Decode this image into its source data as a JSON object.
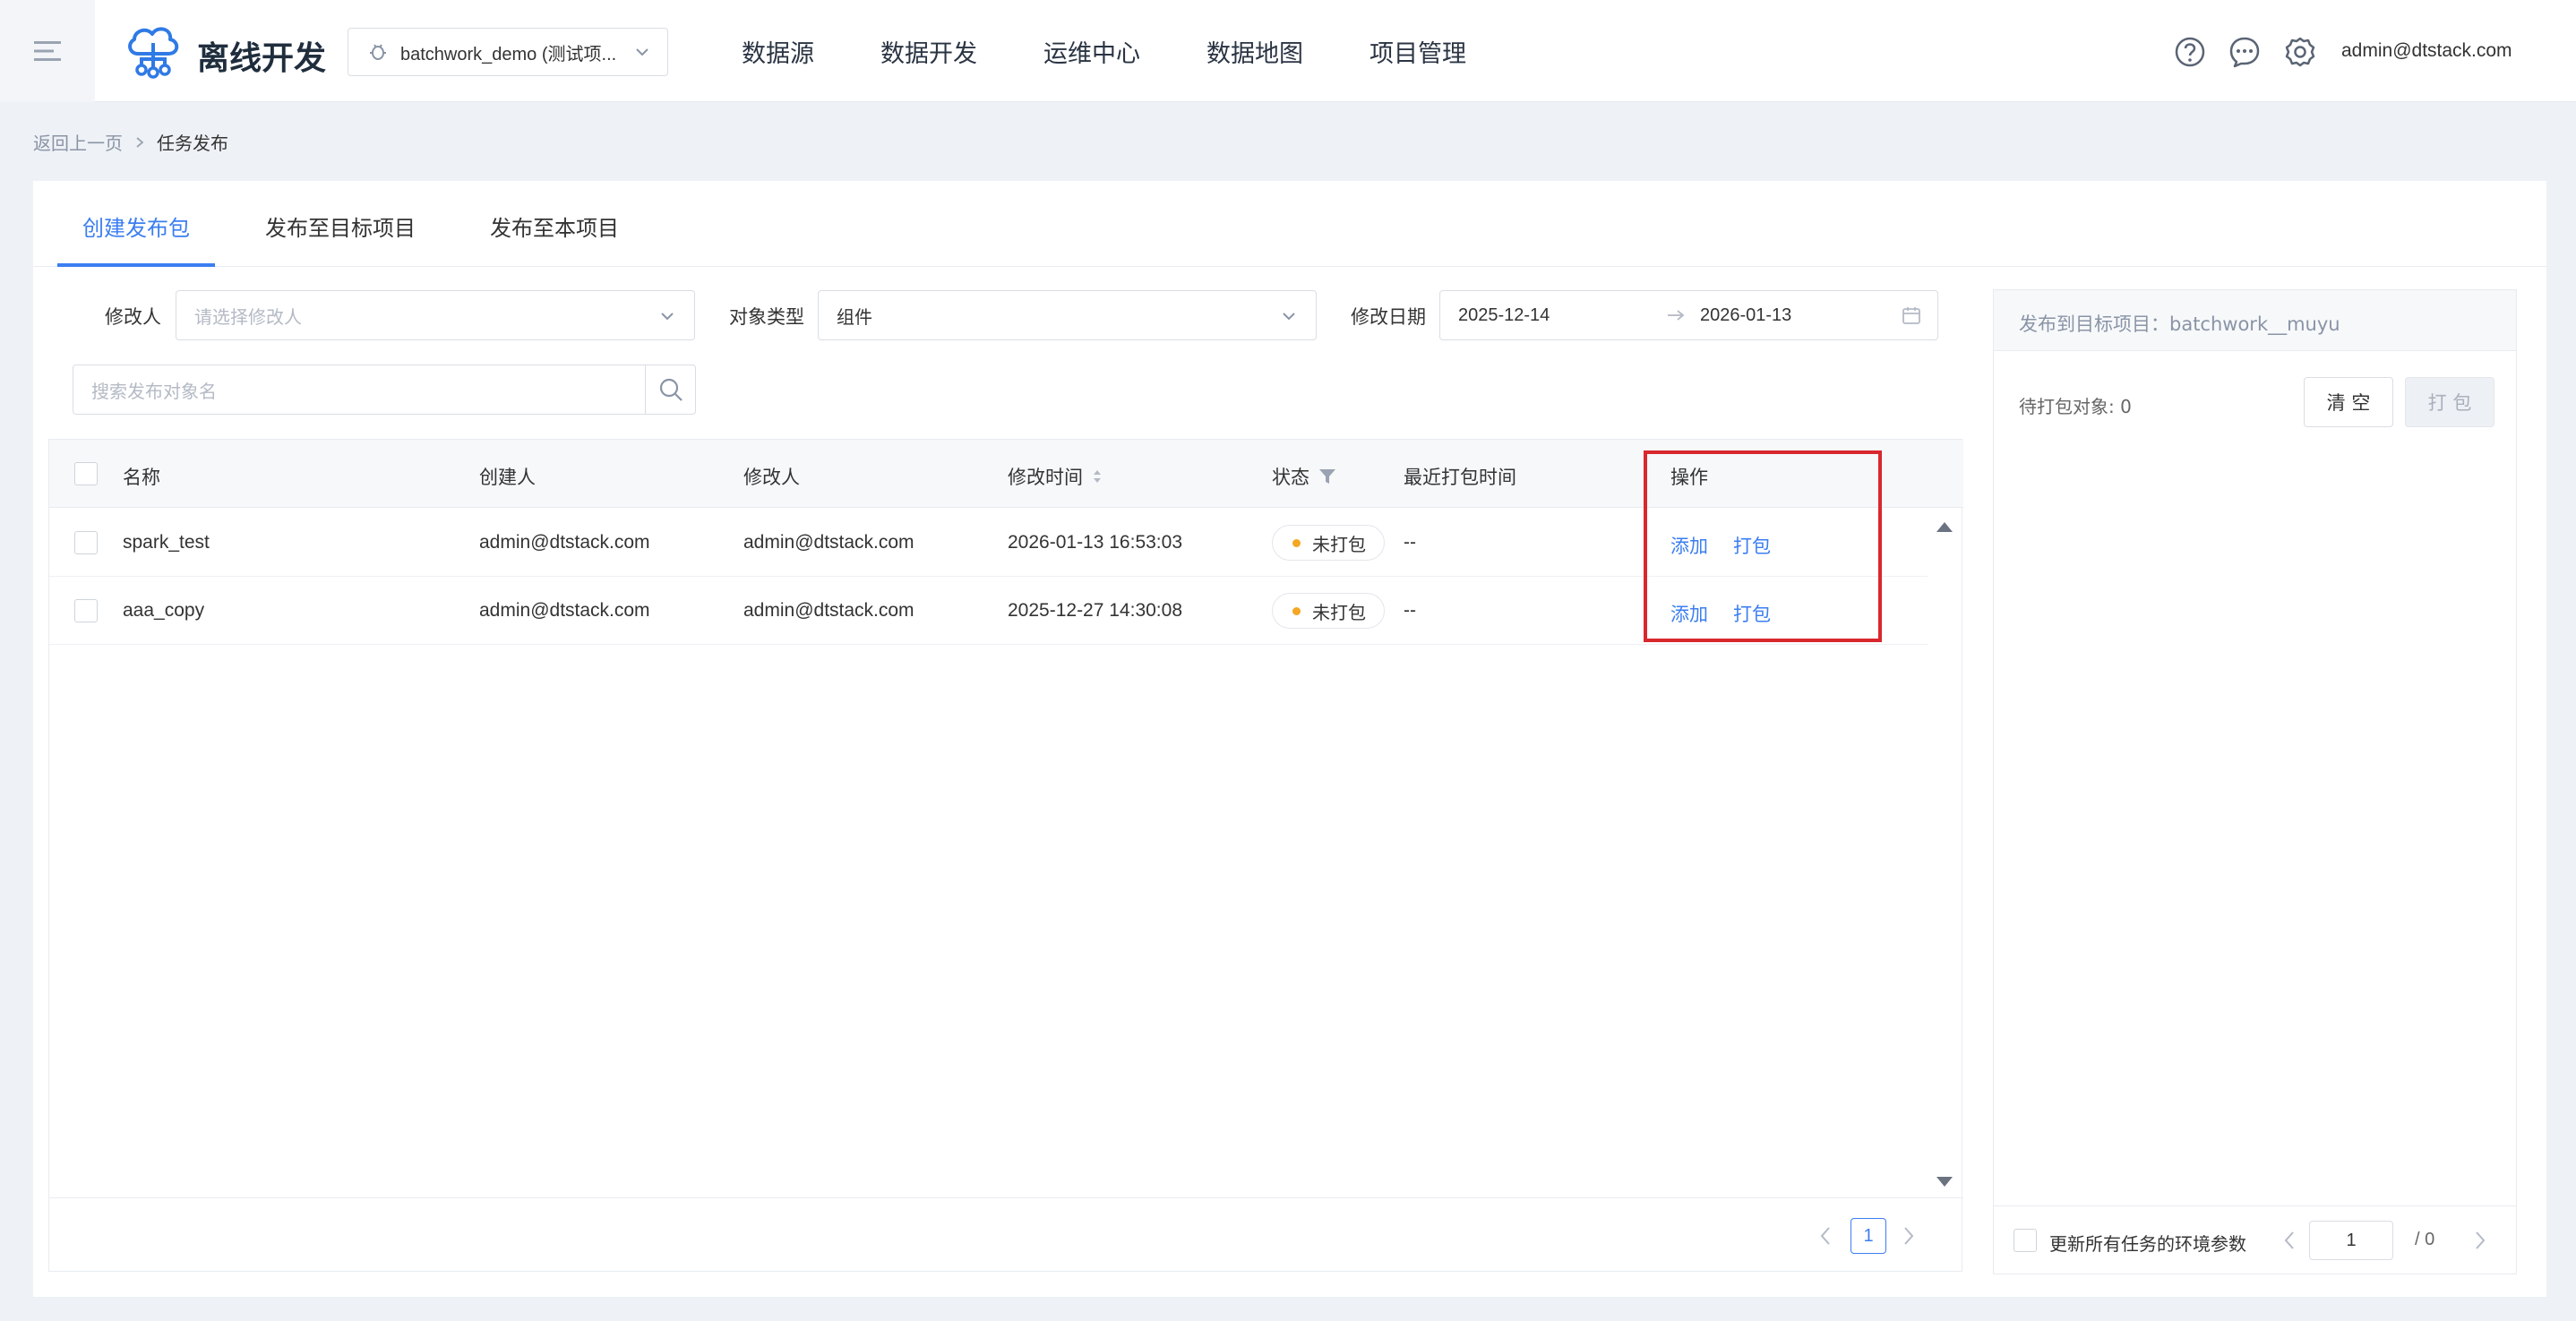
{
  "header": {
    "app_title": "离线开发",
    "project": "batchwork_demo (测试项...",
    "nav": [
      "数据源",
      "数据开发",
      "运维中心",
      "数据地图",
      "项目管理"
    ],
    "user": "admin@dtstack.com"
  },
  "breadcrumb": {
    "back": "返回上一页",
    "current": "任务发布"
  },
  "tabs": [
    "创建发布包",
    "发布至目标项目",
    "发布至本项目"
  ],
  "filters": {
    "modifier_label": "修改人",
    "modifier_placeholder": "请选择修改人",
    "type_label": "对象类型",
    "type_value": "组件",
    "date_label": "修改日期",
    "date_start": "2025-12-14",
    "date_end": "2026-01-13",
    "search_placeholder": "搜索发布对象名"
  },
  "table": {
    "columns": [
      "名称",
      "创建人",
      "修改人",
      "修改时间",
      "状态",
      "最近打包时间",
      "操作"
    ],
    "rows": [
      {
        "name": "spark_test",
        "creator": "admin@dtstack.com",
        "modifier": "admin@dtstack.com",
        "modified": "2026-01-13 16:53:03",
        "status": "未打包",
        "last_pack": "--",
        "add": "添加",
        "pack": "打包"
      },
      {
        "name": "aaa_copy",
        "creator": "admin@dtstack.com",
        "modifier": "admin@dtstack.com",
        "modified": "2025-12-27 14:30:08",
        "status": "未打包",
        "last_pack": "--",
        "add": "添加",
        "pack": "打包"
      }
    ],
    "page": "1"
  },
  "panel": {
    "title": "发布到目标项目：batchwork__muyu",
    "pending": "待打包对象: 0",
    "clear": "清 空",
    "pack": "打 包",
    "update_env": "更新所有任务的环境参数",
    "page": "1",
    "total": "/ 0"
  },
  "colors": {
    "accent": "#3b7ef0",
    "highlight": "#d9272e",
    "status_dot": "#f5a623"
  }
}
